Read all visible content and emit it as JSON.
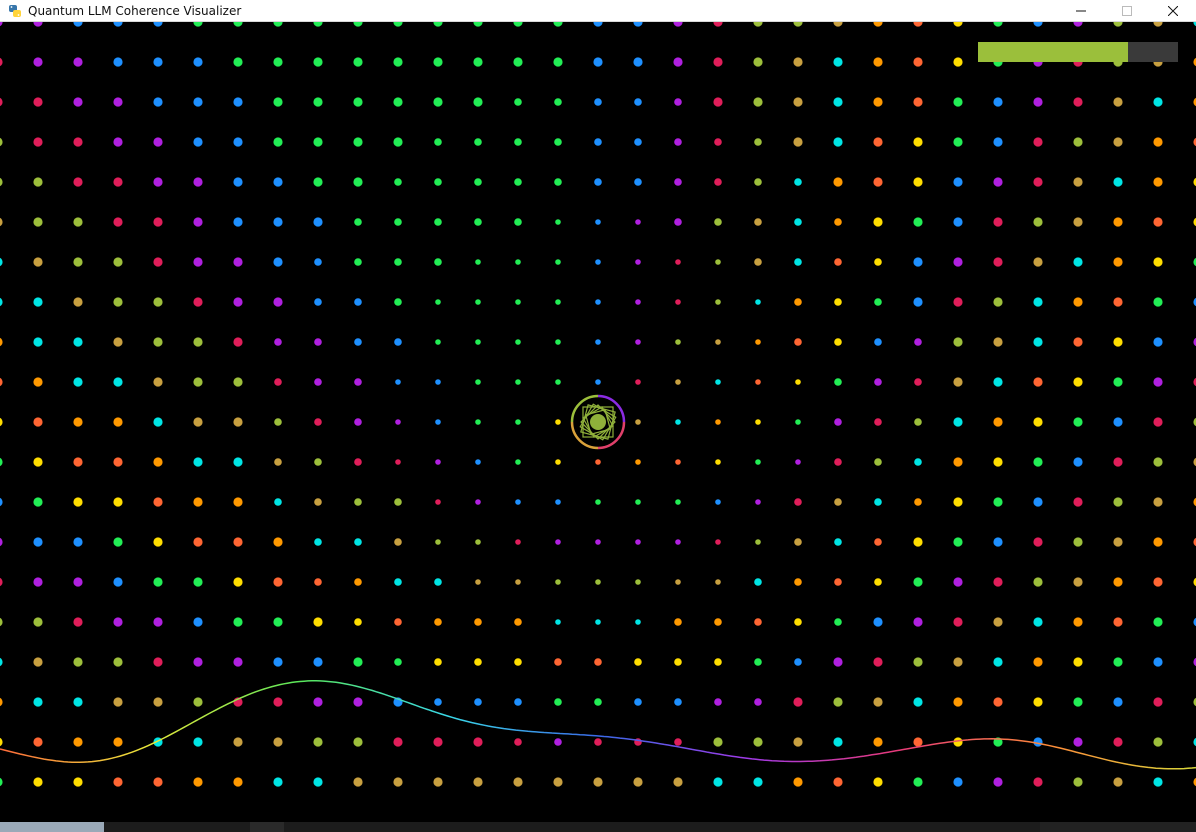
{
  "window": {
    "title": "Quantum LLM Coherence Visualizer",
    "icon": "python-icon",
    "controls": [
      "minimize-icon",
      "maximize-icon",
      "close-icon"
    ]
  },
  "visualization": {
    "background_color": "#000000",
    "coherence_bar": {
      "level": 0.75,
      "fill_color": "#9bbf3b",
      "track_color": "#3a3a3a"
    },
    "center_orb": {
      "ring_colors": [
        "#8a2be2",
        "#e0406a",
        "#d9a23a",
        "#9bbf3b"
      ],
      "core_color": "#8fb03a"
    },
    "wave_colors": [
      "#ff6a3a",
      "#e8e83a",
      "#5ae85a",
      "#3ad8e8",
      "#3a6ae8",
      "#a03ae8",
      "#e83a7a",
      "#ff8a3a",
      "#d8d83a"
    ],
    "dot_palette": [
      "#ff6633",
      "#ffdd00",
      "#22ee55",
      "#1e90ff",
      "#b020e0",
      "#e01e5a",
      "#9dbf3b",
      "#c8a040",
      "#00e5e5",
      "#ff9900"
    ]
  }
}
